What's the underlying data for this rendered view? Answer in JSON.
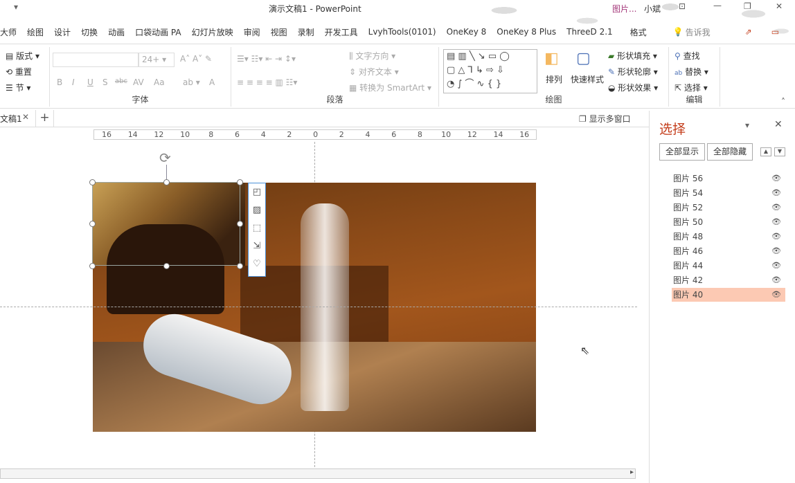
{
  "titlebar": {
    "title": "演示文稿1  -  PowerPoint",
    "context_tab": "图片...",
    "user": "小斌",
    "qat_dropdown": "▾"
  },
  "tabs": [
    "大师",
    "绘图",
    "设计",
    "切换",
    "动画",
    "口袋动画 PA",
    "幻灯片放映",
    "审阅",
    "视图",
    "录制",
    "开发工具",
    "LvyhTools(0101)",
    "OneKey 8",
    "OneKey 8 Plus",
    "ThreeD 2.1",
    "格式"
  ],
  "tell_me": "告诉我",
  "ribbon": {
    "slides": {
      "layout": "版式",
      "reset": "重置",
      "section": "节"
    },
    "font": {
      "label": "字体",
      "size": "24+",
      "bold": "B",
      "italic": "I",
      "underline": "U",
      "shadow": "S",
      "strike": "abc",
      "spacing": "AV",
      "case": "Aa",
      "color": "A"
    },
    "paragraph": {
      "label": "段落",
      "text_dir": "文字方向",
      "align_text": "对齐文本",
      "smartart": "转换为 SmartArt"
    },
    "drawing": {
      "label": "绘图",
      "arrange": "排列",
      "quick_styles": "快速样式",
      "fill": "形状填充",
      "outline": "形状轮廓",
      "effects": "形状效果"
    },
    "editing": {
      "label": "编辑",
      "find": "查找",
      "replace": "替换",
      "select": "选择"
    }
  },
  "doc_tab": {
    "name": "文稿1",
    "new": "+"
  },
  "multi_window": "显示多窗口",
  "ruler": [
    "16",
    "14",
    "12",
    "10",
    "8",
    "6",
    "4",
    "2",
    "0",
    "2",
    "4",
    "6",
    "8",
    "10",
    "12",
    "14",
    "16"
  ],
  "pane": {
    "title": "选择",
    "show_all": "全部显示",
    "hide_all": "全部隐藏",
    "items": [
      {
        "name": "图片 56"
      },
      {
        "name": "图片 54"
      },
      {
        "name": "图片 52"
      },
      {
        "name": "图片 50"
      },
      {
        "name": "图片 48"
      },
      {
        "name": "图片 46"
      },
      {
        "name": "图片 44"
      },
      {
        "name": "图片 42"
      },
      {
        "name": "图片 40",
        "selected": true
      }
    ]
  },
  "colors": {
    "accent": "#c43e1c",
    "selected": "#fcc9b3",
    "context": "#a4377a"
  }
}
